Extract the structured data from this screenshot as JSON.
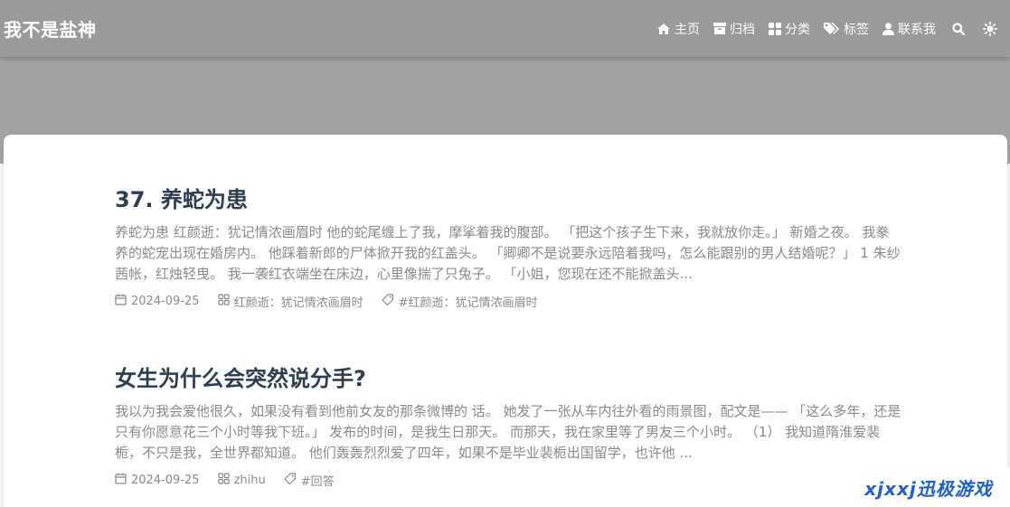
{
  "site": {
    "brand": "我不是盐神"
  },
  "nav": [
    {
      "label": "主页",
      "icon": "home-icon"
    },
    {
      "label": "归档",
      "icon": "archive-icon"
    },
    {
      "label": "分类",
      "icon": "grid-icon"
    },
    {
      "label": "标签",
      "icon": "tags-icon"
    },
    {
      "label": "联系我",
      "icon": "user-icon"
    }
  ],
  "nav_tools": [
    {
      "icon": "search-icon"
    },
    {
      "icon": "sun-icon"
    }
  ],
  "posts": [
    {
      "title": "37. 养蛇为患",
      "excerpt": "养蛇为患 红颜逝：犹记情浓画眉时 他的蛇尾缠上了我，摩挲着我的腹部。 「把这个孩子生下来，我就放你走。」 新婚之夜。 我豢养的蛇宠出现在婚房内。 他踩着新郎的尸体掀开我的红盖头。 「卿卿不是说要永远陪着我吗，怎么能跟别的男人结婚呢？」 1 朱纱茜帐，红烛轻曳。 我一袭红衣端坐在床边，心里像揣了只兔子。 「小姐，您现在还不能掀盖头...",
      "date": "2024-09-25",
      "category": "红颜逝：犹记情浓画眉时",
      "tag": "#红颜逝：犹记情浓画眉时"
    },
    {
      "title": "女生为什么会突然说分手?",
      "excerpt": "我以为我会爱他很久，如果没有看到他前女友的那条微博的 话。 她发了一张从车内往外看的雨景图，配文是—— 「这么多年，还是只有你愿意花三个小时等我下班。」 发布的时间，是我生日那天。 而那天，我在家里等了男友三个小时。 （1） 我知道隋淮爱裴栀，不只是我，全世界都知道。 他们轰轰烈烈爱了四年，如果不是毕业裴栀出国留学，也许他 ...",
      "date": "2024-09-25",
      "category": "zhihu",
      "tag": "#回答"
    }
  ],
  "watermark": "xjxxj迅极游戏",
  "colors": {
    "navbar": "#9a9a9a",
    "hero": "#a3a3a3",
    "title": "#2c3e50",
    "text": "#8a8a8a",
    "watermark": "#1f5fcf"
  }
}
